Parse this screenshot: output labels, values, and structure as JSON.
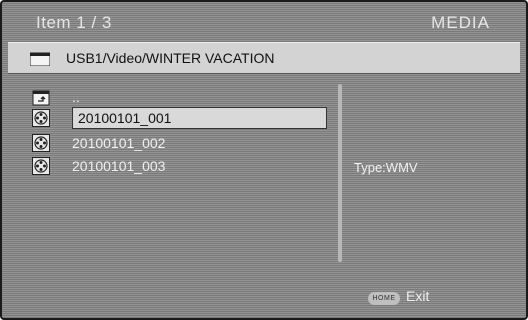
{
  "header": {
    "item_counter": "Item 1 / 3",
    "source_label": "MEDIA"
  },
  "path_bar": {
    "icon": "folder-icon",
    "path": "USB1/Video/WINTER VACATION"
  },
  "file_list": [
    {
      "icon": "parent-folder-icon",
      "label": "..",
      "selected": false
    },
    {
      "icon": "video-file-icon",
      "label": "20100101_001",
      "selected": true
    },
    {
      "icon": "video-file-icon",
      "label": "20100101_002",
      "selected": false
    },
    {
      "icon": "video-file-icon",
      "label": "20100101_003",
      "selected": false
    }
  ],
  "info_panel": {
    "type_text": "Type:WMV"
  },
  "footer": {
    "home_button_label": "HOME",
    "exit_label": "Exit"
  }
}
